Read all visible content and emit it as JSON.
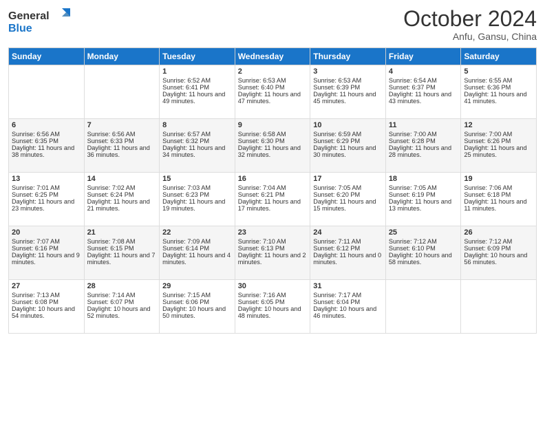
{
  "header": {
    "logo_text_general": "General",
    "logo_text_blue": "Blue",
    "month_title": "October 2024",
    "subtitle": "Anfu, Gansu, China"
  },
  "days_of_week": [
    "Sunday",
    "Monday",
    "Tuesday",
    "Wednesday",
    "Thursday",
    "Friday",
    "Saturday"
  ],
  "weeks": [
    [
      {
        "day": "",
        "content": ""
      },
      {
        "day": "",
        "content": ""
      },
      {
        "day": "1",
        "content": "Sunrise: 6:52 AM\nSunset: 6:41 PM\nDaylight: 11 hours and 49 minutes."
      },
      {
        "day": "2",
        "content": "Sunrise: 6:53 AM\nSunset: 6:40 PM\nDaylight: 11 hours and 47 minutes."
      },
      {
        "day": "3",
        "content": "Sunrise: 6:53 AM\nSunset: 6:39 PM\nDaylight: 11 hours and 45 minutes."
      },
      {
        "day": "4",
        "content": "Sunrise: 6:54 AM\nSunset: 6:37 PM\nDaylight: 11 hours and 43 minutes."
      },
      {
        "day": "5",
        "content": "Sunrise: 6:55 AM\nSunset: 6:36 PM\nDaylight: 11 hours and 41 minutes."
      }
    ],
    [
      {
        "day": "6",
        "content": "Sunrise: 6:56 AM\nSunset: 6:35 PM\nDaylight: 11 hours and 38 minutes."
      },
      {
        "day": "7",
        "content": "Sunrise: 6:56 AM\nSunset: 6:33 PM\nDaylight: 11 hours and 36 minutes."
      },
      {
        "day": "8",
        "content": "Sunrise: 6:57 AM\nSunset: 6:32 PM\nDaylight: 11 hours and 34 minutes."
      },
      {
        "day": "9",
        "content": "Sunrise: 6:58 AM\nSunset: 6:30 PM\nDaylight: 11 hours and 32 minutes."
      },
      {
        "day": "10",
        "content": "Sunrise: 6:59 AM\nSunset: 6:29 PM\nDaylight: 11 hours and 30 minutes."
      },
      {
        "day": "11",
        "content": "Sunrise: 7:00 AM\nSunset: 6:28 PM\nDaylight: 11 hours and 28 minutes."
      },
      {
        "day": "12",
        "content": "Sunrise: 7:00 AM\nSunset: 6:26 PM\nDaylight: 11 hours and 25 minutes."
      }
    ],
    [
      {
        "day": "13",
        "content": "Sunrise: 7:01 AM\nSunset: 6:25 PM\nDaylight: 11 hours and 23 minutes."
      },
      {
        "day": "14",
        "content": "Sunrise: 7:02 AM\nSunset: 6:24 PM\nDaylight: 11 hours and 21 minutes."
      },
      {
        "day": "15",
        "content": "Sunrise: 7:03 AM\nSunset: 6:23 PM\nDaylight: 11 hours and 19 minutes."
      },
      {
        "day": "16",
        "content": "Sunrise: 7:04 AM\nSunset: 6:21 PM\nDaylight: 11 hours and 17 minutes."
      },
      {
        "day": "17",
        "content": "Sunrise: 7:05 AM\nSunset: 6:20 PM\nDaylight: 11 hours and 15 minutes."
      },
      {
        "day": "18",
        "content": "Sunrise: 7:05 AM\nSunset: 6:19 PM\nDaylight: 11 hours and 13 minutes."
      },
      {
        "day": "19",
        "content": "Sunrise: 7:06 AM\nSunset: 6:18 PM\nDaylight: 11 hours and 11 minutes."
      }
    ],
    [
      {
        "day": "20",
        "content": "Sunrise: 7:07 AM\nSunset: 6:16 PM\nDaylight: 11 hours and 9 minutes."
      },
      {
        "day": "21",
        "content": "Sunrise: 7:08 AM\nSunset: 6:15 PM\nDaylight: 11 hours and 7 minutes."
      },
      {
        "day": "22",
        "content": "Sunrise: 7:09 AM\nSunset: 6:14 PM\nDaylight: 11 hours and 4 minutes."
      },
      {
        "day": "23",
        "content": "Sunrise: 7:10 AM\nSunset: 6:13 PM\nDaylight: 11 hours and 2 minutes."
      },
      {
        "day": "24",
        "content": "Sunrise: 7:11 AM\nSunset: 6:12 PM\nDaylight: 11 hours and 0 minutes."
      },
      {
        "day": "25",
        "content": "Sunrise: 7:12 AM\nSunset: 6:10 PM\nDaylight: 10 hours and 58 minutes."
      },
      {
        "day": "26",
        "content": "Sunrise: 7:12 AM\nSunset: 6:09 PM\nDaylight: 10 hours and 56 minutes."
      }
    ],
    [
      {
        "day": "27",
        "content": "Sunrise: 7:13 AM\nSunset: 6:08 PM\nDaylight: 10 hours and 54 minutes."
      },
      {
        "day": "28",
        "content": "Sunrise: 7:14 AM\nSunset: 6:07 PM\nDaylight: 10 hours and 52 minutes."
      },
      {
        "day": "29",
        "content": "Sunrise: 7:15 AM\nSunset: 6:06 PM\nDaylight: 10 hours and 50 minutes."
      },
      {
        "day": "30",
        "content": "Sunrise: 7:16 AM\nSunset: 6:05 PM\nDaylight: 10 hours and 48 minutes."
      },
      {
        "day": "31",
        "content": "Sunrise: 7:17 AM\nSunset: 6:04 PM\nDaylight: 10 hours and 46 minutes."
      },
      {
        "day": "",
        "content": ""
      },
      {
        "day": "",
        "content": ""
      }
    ]
  ]
}
